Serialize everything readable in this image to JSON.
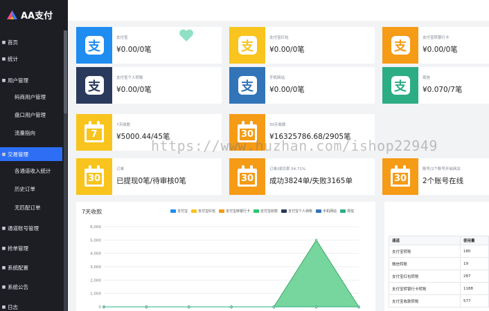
{
  "app": {
    "title": "AA支付"
  },
  "sidebar": {
    "items": [
      {
        "label": "首页",
        "level": "top",
        "active": false
      },
      {
        "label": "统计",
        "level": "top",
        "active": false
      },
      {
        "label": "用户管理",
        "level": "top",
        "active": false
      },
      {
        "label": "码商用户管理",
        "level": "sub",
        "active": false
      },
      {
        "label": "盘口用户管理",
        "level": "sub",
        "active": false
      },
      {
        "label": "流量指向",
        "level": "sub",
        "active": false
      },
      {
        "label": "交易管理",
        "level": "top",
        "active": true
      },
      {
        "label": "各通道收入统计",
        "level": "sub",
        "active": false
      },
      {
        "label": "历史订单",
        "level": "sub",
        "active": false
      },
      {
        "label": "无匹配订单",
        "level": "sub",
        "active": false
      },
      {
        "label": "通道账号管理",
        "level": "top",
        "active": false
      },
      {
        "label": "抢单管理",
        "level": "top",
        "active": false
      },
      {
        "label": "系统配置",
        "level": "top",
        "active": false
      },
      {
        "label": "系统公告",
        "level": "top",
        "active": false
      },
      {
        "label": "日志",
        "level": "top",
        "active": false
      }
    ]
  },
  "cards": [
    {
      "icon": "alipay-icon",
      "color": "#1f8cf0",
      "label": "支付宝",
      "value": "¥0.00/0笔",
      "extra": "heart"
    },
    {
      "icon": "alipay-icon",
      "color": "#f8c41d",
      "label": "支付宝红包",
      "value": "¥0.00/0笔"
    },
    {
      "icon": "alipay-icon",
      "color": "#f59b16",
      "label": "支付宝转银行卡",
      "value": "¥0.00/0笔"
    },
    {
      "icon": "alipay-icon",
      "color": "#2a3a5c",
      "label": "支付宝个人转账",
      "value": "¥0.00/0笔"
    },
    {
      "icon": "alipay-icon",
      "color": "#3174b8",
      "label": "手机网站",
      "value": "¥0.00/0笔"
    },
    {
      "icon": "alipay-icon",
      "color": "#2dad84",
      "label": "现信",
      "value": "¥0.070/7笔"
    },
    {
      "icon": "calendar-icon",
      "color": "#f8c41d",
      "number": "7",
      "label": "7天收款",
      "value": "¥5000.44/45笔"
    },
    {
      "icon": "calendar-icon",
      "color": "#f59b16",
      "number": "30",
      "label": "30天收款",
      "value": "¥16325786.68/2905笔"
    },
    {
      "icon": "calendar-icon",
      "color": "#f8c41d",
      "number": "30",
      "label": "订单",
      "value": "已提现0笔/待审核0笔"
    },
    {
      "icon": "calendar-icon",
      "color": "#f59b16",
      "number": "30",
      "label": "订单/成功率 54.71%",
      "value": "成功3824单/失败3165单"
    },
    {
      "icon": "calendar-icon",
      "color": "#f59b16",
      "number": "30",
      "label": "账号/2个账号开启网关",
      "value": "2个账号在线"
    }
  ],
  "watermark": "https://www.huzhan.com/ishop22949",
  "chart_data": {
    "type": "area",
    "title": "7天收款",
    "x": [
      "",
      "",
      "",
      "",
      "",
      "",
      ""
    ],
    "ylim": [
      0,
      6000
    ],
    "yticks": [
      "0",
      "1,000",
      "2,000",
      "3,000",
      "4,000",
      "5,000",
      "6,000"
    ],
    "grid": true,
    "legend": "top-right",
    "series": [
      {
        "name": "支付宝",
        "color": "#1f8cf0",
        "values": [
          0,
          0,
          0,
          0,
          0,
          0,
          0
        ]
      },
      {
        "name": "支付宝红包",
        "color": "#f8c41d",
        "values": [
          0,
          0,
          0,
          0,
          0,
          0,
          0
        ]
      },
      {
        "name": "支付宝转银行卡",
        "color": "#f59b16",
        "values": [
          0,
          0,
          0,
          0,
          0,
          0,
          0
        ]
      },
      {
        "name": "支付宝收款",
        "color": "#2cc66e",
        "values": [
          0,
          0,
          0,
          0,
          0,
          5000,
          0
        ]
      },
      {
        "name": "支付宝个人转账",
        "color": "#2a3a5c",
        "values": [
          0,
          0,
          0,
          0,
          0,
          0,
          0
        ]
      },
      {
        "name": "手机网站",
        "color": "#3174b8",
        "values": [
          0,
          0,
          0,
          0,
          0,
          0,
          0
        ]
      },
      {
        "name": "现信",
        "color": "#2dad84",
        "values": [
          0,
          0,
          0,
          0,
          0,
          0,
          0
        ]
      }
    ]
  },
  "channel_table": {
    "headers": [
      "通道",
      "使用量"
    ],
    "rows": [
      [
        "支付宝转账",
        "180"
      ],
      [
        "微信转账",
        "19"
      ],
      [
        "支付宝红包转账",
        "287"
      ],
      [
        "支付宝转银行卡转账",
        "1188"
      ],
      [
        "支付宝收款转账",
        "577"
      ]
    ]
  }
}
